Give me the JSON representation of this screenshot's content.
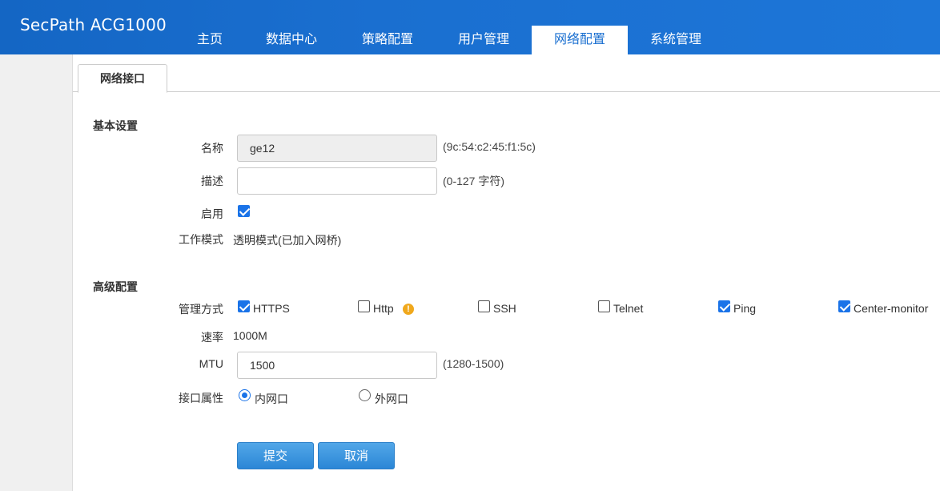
{
  "app": {
    "brand": "SecPath ACG1000"
  },
  "nav": {
    "items": [
      {
        "label": "主页"
      },
      {
        "label": "数据中心"
      },
      {
        "label": "策略配置"
      },
      {
        "label": "用户管理"
      },
      {
        "label": "网络配置",
        "active": true
      },
      {
        "label": "系统管理"
      }
    ]
  },
  "tabs": {
    "active_label": "网络接口"
  },
  "basic": {
    "title": "基本设置",
    "name_label": "名称",
    "name_value": "ge12",
    "name_hint": "(9c:54:c2:45:f1:5c)",
    "desc_label": "描述",
    "desc_value": "",
    "desc_hint": "(0-127 字符)",
    "enable_label": "启用",
    "enable_checked": true,
    "mode_label": "工作模式",
    "mode_value": "透明模式(已加入网桥)"
  },
  "advanced": {
    "title": "高级配置",
    "mgmt_label": "管理方式",
    "mgmt_options": [
      {
        "label": "HTTPS",
        "checked": true
      },
      {
        "label": "Http",
        "checked": false,
        "icon": "warning-icon"
      },
      {
        "label": "SSH",
        "checked": false
      },
      {
        "label": "Telnet",
        "checked": false
      },
      {
        "label": "Ping",
        "checked": true
      },
      {
        "label": "Center-monitor",
        "checked": true
      }
    ],
    "speed_label": "速率",
    "speed_value": "1000M",
    "mtu_label": "MTU",
    "mtu_value": "1500",
    "mtu_hint": "(1280-1500)",
    "iface_label": "接口属性",
    "iface_options": [
      {
        "label": "内网口",
        "selected": true
      },
      {
        "label": "外网口",
        "selected": false
      }
    ]
  },
  "actions": {
    "submit_label": "提交",
    "cancel_label": "取消"
  },
  "colors": {
    "header": "#1a6fd0",
    "accent": "#1a73e8",
    "button": "#2b86d6",
    "warning": "#f0a81c"
  }
}
